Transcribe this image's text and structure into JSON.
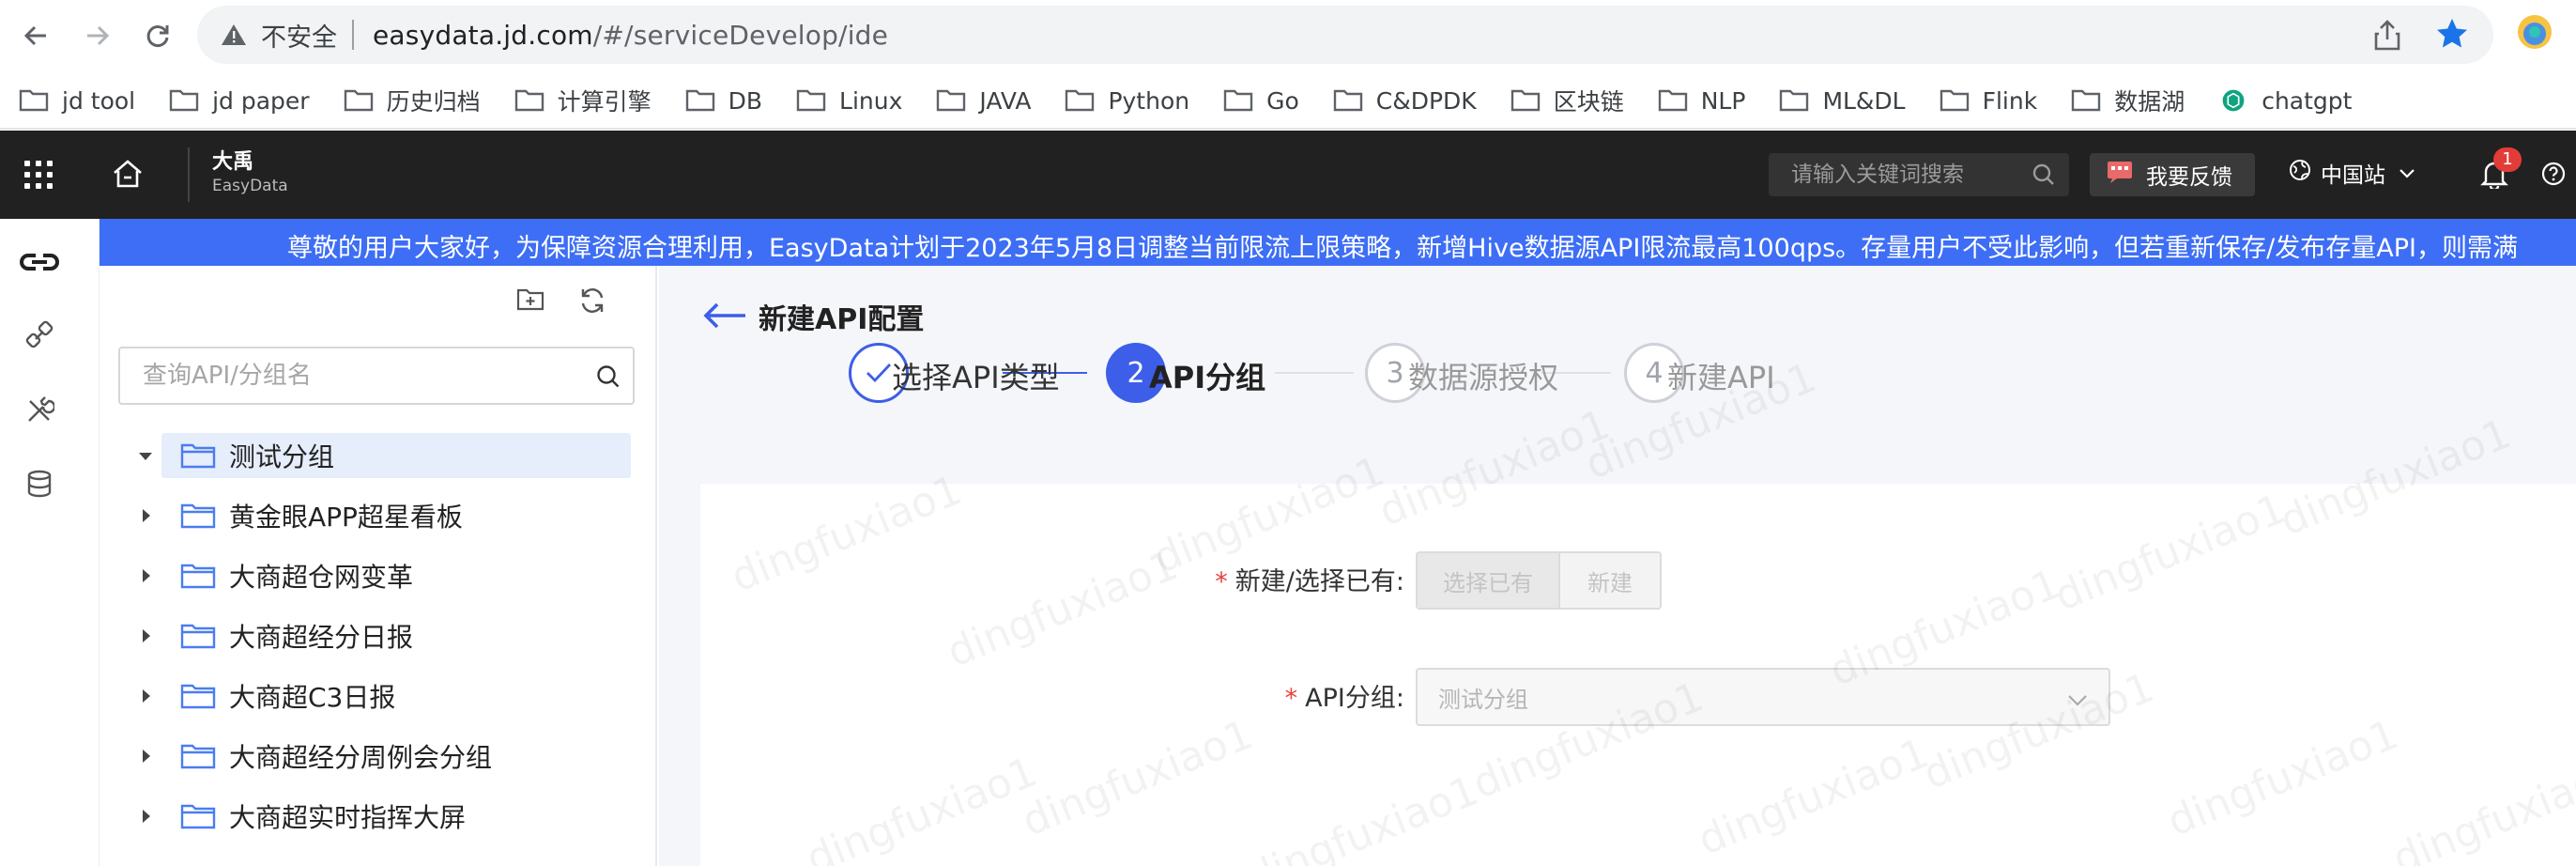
{
  "browser": {
    "insecure_label": "不安全",
    "url_host": "easydata.jd.com",
    "url_path": "/#/serviceDevelop/ide",
    "bookmarks": [
      {
        "label": "jd tool",
        "icon": "folder-icon"
      },
      {
        "label": "jd paper",
        "icon": "folder-icon"
      },
      {
        "label": "历史归档",
        "icon": "folder-icon"
      },
      {
        "label": "计算引擎",
        "icon": "folder-icon"
      },
      {
        "label": "DB",
        "icon": "folder-icon"
      },
      {
        "label": "Linux",
        "icon": "folder-icon"
      },
      {
        "label": "JAVA",
        "icon": "folder-icon"
      },
      {
        "label": "Python",
        "icon": "folder-icon"
      },
      {
        "label": "Go",
        "icon": "folder-icon"
      },
      {
        "label": "C&DPDK",
        "icon": "folder-icon"
      },
      {
        "label": "区块链",
        "icon": "folder-icon"
      },
      {
        "label": "NLP",
        "icon": "folder-icon"
      },
      {
        "label": "ML&DL",
        "icon": "folder-icon"
      },
      {
        "label": "Flink",
        "icon": "folder-icon"
      },
      {
        "label": "数据湖",
        "icon": "folder-icon"
      },
      {
        "label": "chatgpt",
        "icon": "chatgpt-icon"
      }
    ]
  },
  "header": {
    "brand_cn": "大禹",
    "brand_en": "EasyData",
    "search_placeholder": "请输入关键词搜索",
    "feedback_label": "我要反馈",
    "region_label": "中国站",
    "notification_count": "1"
  },
  "notice": {
    "text": "尊敬的用户大家好，为保障资源合理利用，EasyData计划于2023年5月8日调整当前限流上限策略，新增Hive数据源API限流最高100qps。存量用户不受此影响，但若重新保存/发布存量API，则需满"
  },
  "tree": {
    "search_placeholder": "查询API/分组名",
    "items": [
      {
        "label": "测试分组",
        "expanded": true,
        "selected": true
      },
      {
        "label": "黄金眼APP超星看板",
        "expanded": false,
        "selected": false
      },
      {
        "label": "大商超仓网变革",
        "expanded": false,
        "selected": false
      },
      {
        "label": "大商超经分日报",
        "expanded": false,
        "selected": false
      },
      {
        "label": "大商超C3日报",
        "expanded": false,
        "selected": false
      },
      {
        "label": "大商超经分周例会分组",
        "expanded": false,
        "selected": false
      },
      {
        "label": "大商超实时指挥大屏",
        "expanded": false,
        "selected": false
      }
    ]
  },
  "main": {
    "title": "新建API配置",
    "steps": [
      {
        "number": "1",
        "label": "选择API类型",
        "status": "done"
      },
      {
        "number": "2",
        "label": "API分组",
        "status": "active"
      },
      {
        "number": "3",
        "label": "数据源授权",
        "status": "wait"
      },
      {
        "number": "4",
        "label": "新建API",
        "status": "wait"
      }
    ],
    "form": {
      "mode_label": "新建/选择已有",
      "mode_options": [
        "选择已有",
        "新建"
      ],
      "mode_selected": "选择已有",
      "group_label": "API分组",
      "group_value": "测试分组",
      "required_mark": "*",
      "colon": ":"
    }
  },
  "watermark": "dingfuxiao1",
  "colors": {
    "primary": "#3d5ee8",
    "notice_bg": "#3d6ef5",
    "header_bg": "#212121",
    "badge": "#e23c39"
  }
}
